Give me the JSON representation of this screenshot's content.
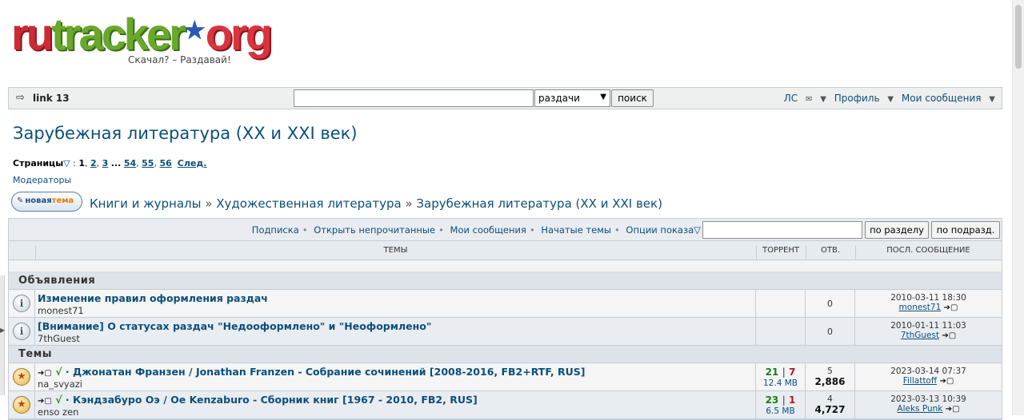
{
  "logo": {
    "part1": "ru",
    "part2": "tracker",
    "part3": "org",
    "slogan": "Скачал? – Раздавай!"
  },
  "topbar": {
    "link_label": "link 13",
    "search_value": "",
    "search_scope": "раздачи",
    "search_button": "поиск",
    "pm_label": "ЛС",
    "profile_label": "Профиль",
    "my_posts_label": "Мои сообщения"
  },
  "page": {
    "title": "Зарубежная литература (XX и XXI век)",
    "pages_label": "Страницы",
    "pages": [
      "1",
      "2",
      "3",
      "54",
      "55",
      "56"
    ],
    "next_label": "След.",
    "moderators_label": "Модераторы"
  },
  "new_topic": {
    "part1": "новая",
    "part2": "тема"
  },
  "breadcrumb": [
    "Книги и журналы",
    "Художественная литература",
    "Зарубежная литература (XX и XXI век)"
  ],
  "tools": {
    "links": [
      "Подписка",
      "Открыть непрочитанные",
      "Мои сообщения",
      "Начатые темы",
      "Опции показа"
    ],
    "filter_value": "",
    "btn_section": "по разделу",
    "btn_subsection": "по подразд."
  },
  "columns": {
    "topics": "ТЕМЫ",
    "torrent": "ТОРРЕНТ",
    "replies": "ОТВ.",
    "last_post": "ПОСЛ. СООБЩЕНИЕ"
  },
  "categories": {
    "announcements": "Объявления",
    "topics": "Темы"
  },
  "announcements": [
    {
      "title": "Изменение правил оформления раздач",
      "author": "monest71",
      "replies": "0",
      "last_date": "2010-03-11 18:30",
      "last_user": "monest71"
    },
    {
      "title": "[Внимание] О статусах раздач \"Недооформлено\" и \"Неоформлено\"",
      "author": "7thGuest",
      "replies": "0",
      "last_date": "2010-01-11 11:03",
      "last_user": "7thGuest"
    }
  ],
  "topics": [
    {
      "title": "Джонатан Франзен / Jonathan Franzen - Собрание сочинений [2008-2016, FB2+RTF, RUS]",
      "author": "na_svyazi",
      "seeders": "21",
      "leechers": "7",
      "size": "12.4 MB",
      "replies": "5",
      "views": "2,886",
      "last_date": "2023-03-14 07:37",
      "last_user": "Fillattoff"
    },
    {
      "title": "Кэндзабуро Оэ / Oe Kenzaburo - Сборник книг [1967 - 2010, FB2, RUS]",
      "author": "enso zen",
      "seeders": "23",
      "leechers": "1",
      "size": "6.5 MB",
      "replies": "4",
      "views": "4,727",
      "last_date": "2023-03-13 10:39",
      "last_user": "Aleks Punk"
    }
  ]
}
